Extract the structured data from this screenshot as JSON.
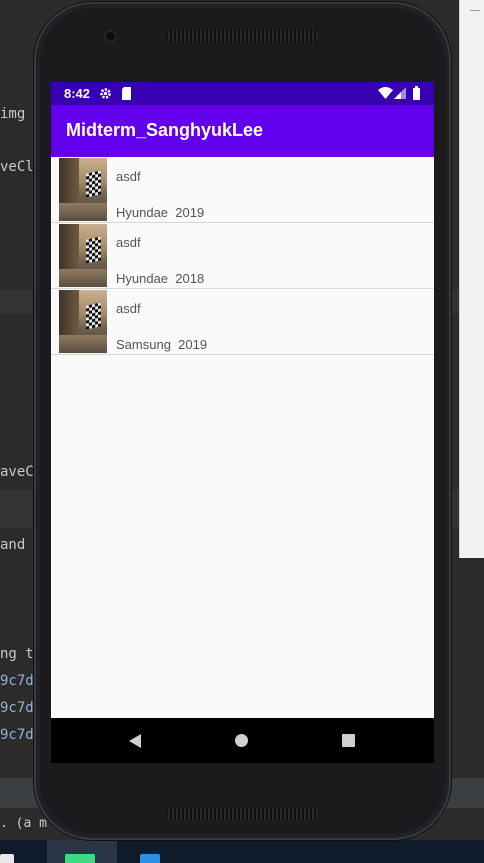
{
  "ide": {
    "code_fragments": [
      "img",
      "veCl",
      "aveC",
      " and",
      "ng t",
      "9c7d",
      "9c7d",
      "9c7d",
      ". (a m"
    ]
  },
  "status_bar": {
    "time": "8:42",
    "icons": [
      "gear-icon",
      "sd-card-icon",
      "wifi-icon",
      "signal-icon",
      "battery-icon"
    ]
  },
  "app_bar": {
    "title": "Midterm_SanghyukLee",
    "color": "#6200ee",
    "status_color": "#3700b3"
  },
  "list": {
    "items": [
      {
        "name": "asdf",
        "meta": "Hyundae  2019"
      },
      {
        "name": "asdf",
        "meta": "Hyundae  2018"
      },
      {
        "name": "asdf",
        "meta": "Samsung  2019"
      }
    ]
  },
  "nav_bar": {
    "icons": [
      "back-icon",
      "home-icon",
      "recents-icon"
    ]
  }
}
